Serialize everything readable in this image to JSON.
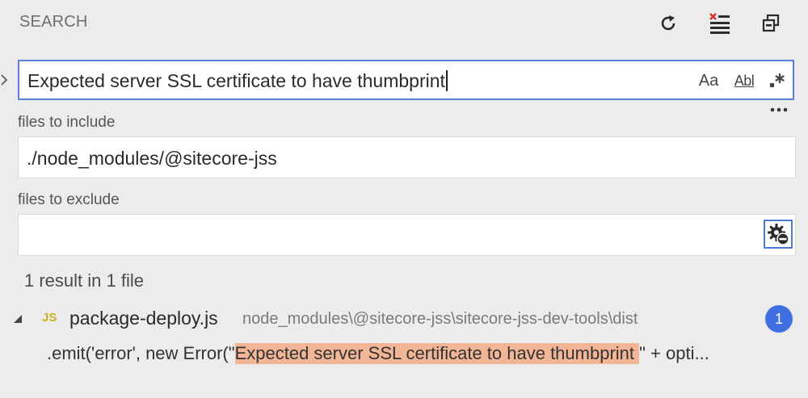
{
  "header": {
    "title": "SEARCH",
    "icons": [
      "refresh-icon",
      "clear-results-icon",
      "collapse-all-icon"
    ]
  },
  "search": {
    "query": "Expected server SSL certificate to have thumbprint",
    "options": {
      "match_case_label": "Aa",
      "whole_word_label": "Abl",
      "regex_icon": "regex-icon"
    },
    "more_icon": "ellipsis-icon"
  },
  "include": {
    "label": "files to include",
    "value": "./node_modules/@sitecore-jss"
  },
  "exclude": {
    "label": "files to exclude",
    "value": "",
    "settings_icon": "gear-exclude-icon"
  },
  "results": {
    "summary": "1 result in 1 file",
    "files": [
      {
        "icon_label": "JS",
        "name": "package-deploy.js",
        "path": "node_modules\\@sitecore-jss\\sitecore-jss-dev-tools\\dist",
        "count": "1",
        "matches": [
          {
            "before": ".emit('error', new Error(\"",
            "match": "Expected server SSL certificate to have thumbprint ",
            "after": "\" + opti..."
          }
        ]
      }
    ]
  },
  "colors": {
    "background": "#ececec",
    "accent": "#3f6fe0",
    "match_highlight": "#f2b697",
    "js_icon": "#c8b01a",
    "close_red": "#d9302c"
  }
}
